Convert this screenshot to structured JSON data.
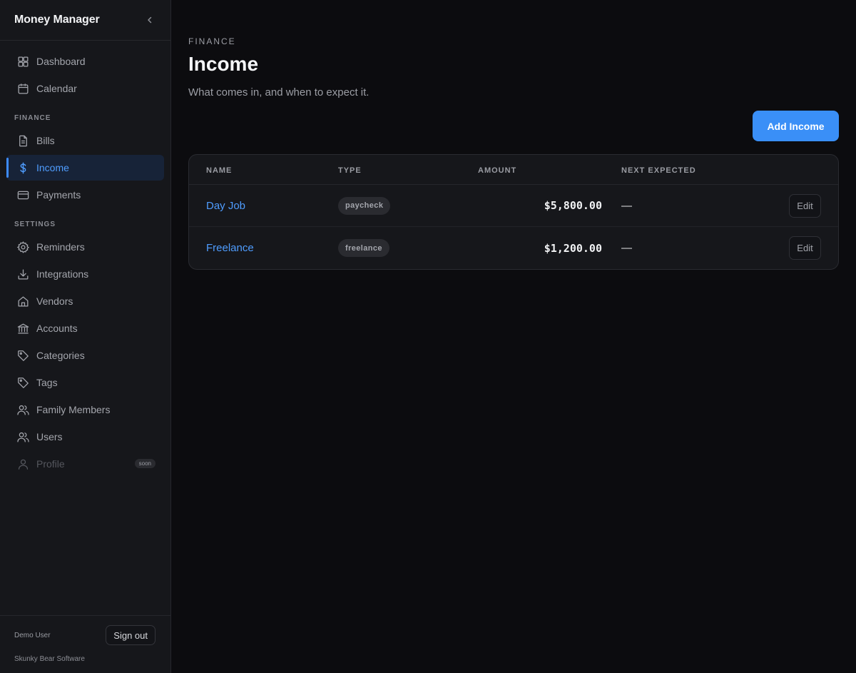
{
  "app": {
    "title": "Money Manager"
  },
  "sidebar": {
    "collapse_icon": "chevron-left-icon",
    "top_items": [
      {
        "label": "Dashboard",
        "icon": "grid-icon"
      },
      {
        "label": "Calendar",
        "icon": "calendar-icon"
      }
    ],
    "finance_label": "FINANCE",
    "finance_items": [
      {
        "label": "Bills",
        "icon": "document-icon"
      },
      {
        "label": "Income",
        "icon": "dollar-icon",
        "active": true
      },
      {
        "label": "Payments",
        "icon": "credit-card-icon"
      }
    ],
    "settings_label": "SETTINGS",
    "settings_items": [
      {
        "label": "Reminders",
        "icon": "gear-icon"
      },
      {
        "label": "Integrations",
        "icon": "download-icon"
      },
      {
        "label": "Vendors",
        "icon": "house-icon"
      },
      {
        "label": "Accounts",
        "icon": "bank-icon"
      },
      {
        "label": "Categories",
        "icon": "tag-icon"
      },
      {
        "label": "Tags",
        "icon": "tag-icon"
      },
      {
        "label": "Family Members",
        "icon": "users-icon"
      },
      {
        "label": "Users",
        "icon": "users-icon"
      },
      {
        "label": "Profile",
        "icon": "user-icon",
        "disabled": true,
        "badge": "soon"
      }
    ],
    "footer": {
      "user_name": "Demo User",
      "sign_out_label": "Sign out",
      "company": "Skunky Bear Software"
    }
  },
  "page": {
    "eyebrow": "FINANCE",
    "title": "Income",
    "subtitle": "What comes in, and when to expect it.",
    "add_button_label": "Add Income"
  },
  "table": {
    "columns": [
      "NAME",
      "TYPE",
      "AMOUNT",
      "NEXT EXPECTED"
    ],
    "rows": [
      {
        "name": "Day Job",
        "type": "paycheck",
        "amount": "$5,800.00",
        "next_expected": "—",
        "action": "Edit"
      },
      {
        "name": "Freelance",
        "type": "freelance",
        "amount": "$1,200.00",
        "next_expected": "—",
        "action": "Edit"
      }
    ]
  },
  "colors": {
    "accent": "#3a8ff7",
    "link": "#4f9dff",
    "sidebar_bg": "#16171b",
    "page_bg": "#0c0c0f"
  }
}
